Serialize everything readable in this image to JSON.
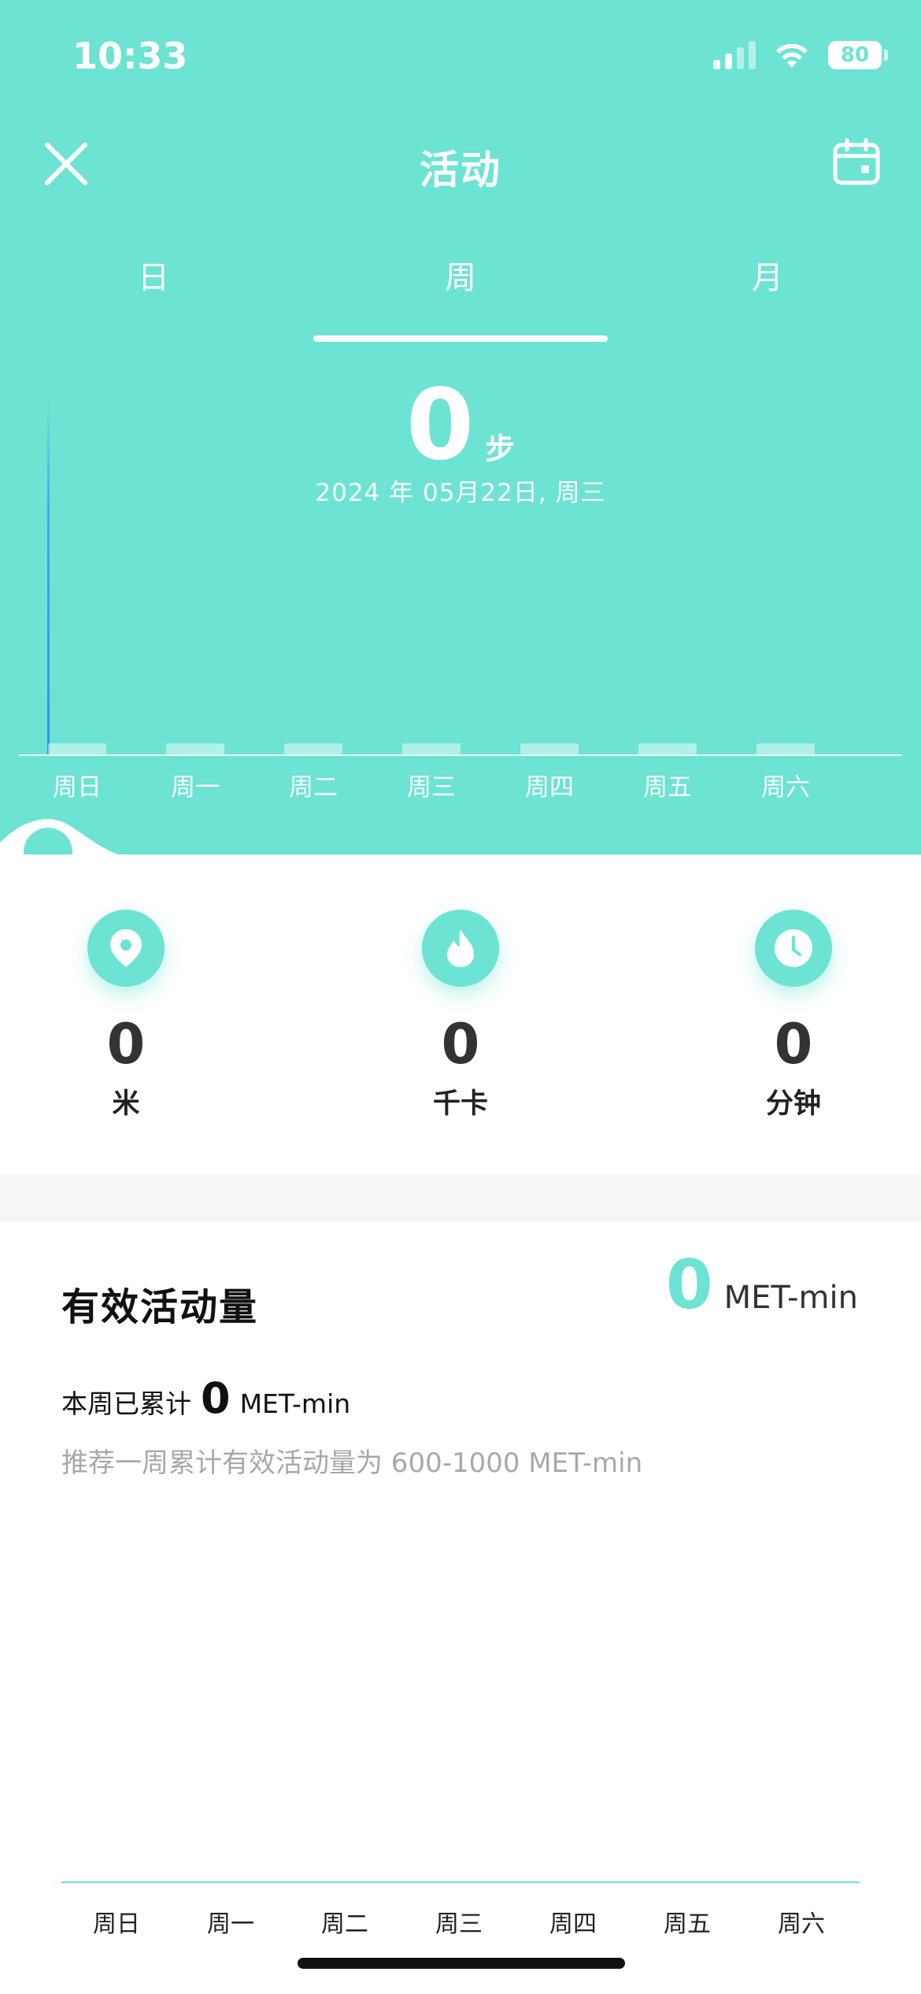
{
  "status": {
    "time": "10:33",
    "battery": "80",
    "icons": [
      "signal-icon",
      "wifi-icon",
      "battery-icon"
    ]
  },
  "header": {
    "title": "活动",
    "close_icon": "close-icon",
    "calendar_icon": "calendar-icon"
  },
  "tabs": [
    {
      "label": "日"
    },
    {
      "label": "周",
      "active": true
    },
    {
      "label": "月"
    }
  ],
  "summary": {
    "steps": "0",
    "steps_unit": "步",
    "date": "2024 年 05月22日, 周三"
  },
  "chart_data": {
    "type": "bar",
    "categories": [
      "周日",
      "周一",
      "周二",
      "周三",
      "周四",
      "周五",
      "周六"
    ],
    "values": [
      0,
      0,
      0,
      0,
      0,
      0,
      0
    ]
  },
  "stats": [
    {
      "icon": "location-icon",
      "value": "0",
      "unit": "米"
    },
    {
      "icon": "flame-icon",
      "value": "0",
      "unit": "千卡"
    },
    {
      "icon": "clock-icon",
      "value": "0",
      "unit": "分钟"
    }
  ],
  "met": {
    "title": "有效活动量",
    "value": "0",
    "unit": "MET-min",
    "week_label": "本周已累计",
    "week_value": "0",
    "week_unit": "MET-min",
    "recommendation": "推荐一周累计有效活动量为 600-1000 MET-min",
    "days": [
      "周日",
      "周一",
      "周二",
      "周三",
      "周四",
      "周五",
      "周六"
    ]
  },
  "colors": {
    "accent": "#6de3d3",
    "text_dark": "#111111",
    "text_muted": "#a8a8a8"
  }
}
